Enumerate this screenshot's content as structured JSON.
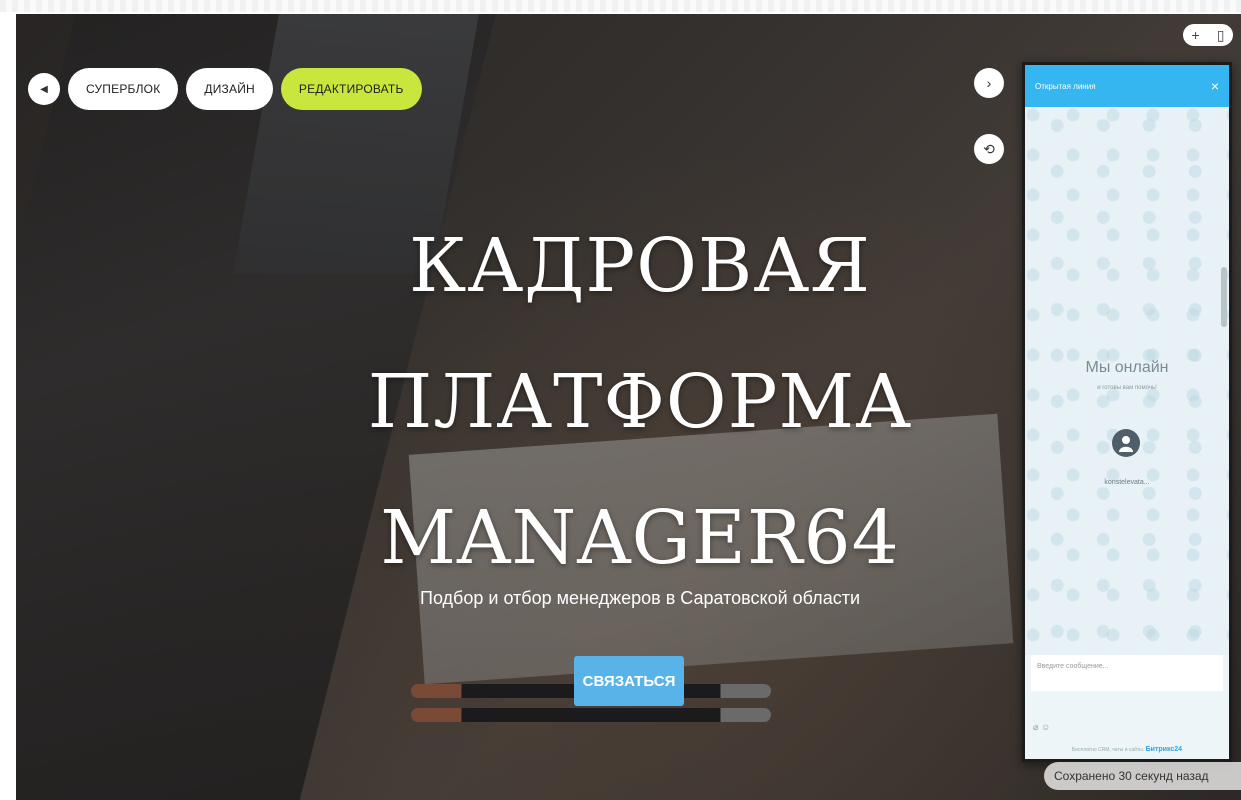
{
  "editor": {
    "back_icon": "chevron-left-icon",
    "superblock": "СУПЕРБЛОК",
    "design": "ДИЗАЙН",
    "edit": "РЕДАКТИРОВАТЬ"
  },
  "hero": {
    "title_line1": "КАДРОВАЯ",
    "title_line2": "ПЛАТФОРМА",
    "title_line3": "MANAGER64",
    "subtitle": "Подбор и отбор менеджеров в Саратовской области",
    "cta_label": "СВЯЗАТЬСЯ",
    "cta_color": "#58b3e9"
  },
  "controls": {
    "plus": "+",
    "trash_icon": "trash-icon",
    "next_icon": "chevron-right-icon",
    "link_icon": "link-icon"
  },
  "chat": {
    "header_title": "Открытая линия",
    "close": "×",
    "online_title": "Мы онлайн",
    "online_sub": "и готовы вам помочь!",
    "operator_name": "konstelevata...",
    "input_placeholder": "Введите сообщение...",
    "footer_text": "Бесплатно CRM, чаты и сайты.",
    "footer_brand": "Битрикс24",
    "accent": "#35b6f0"
  },
  "notice": {
    "text": "Сохранено 30 секунд назад"
  }
}
